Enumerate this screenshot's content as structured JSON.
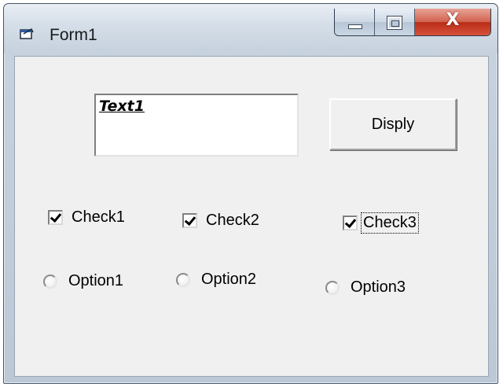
{
  "window": {
    "title": "Form1",
    "close_glyph": "X",
    "icons": {
      "app": "form-app-icon",
      "minimize": "minimize-icon",
      "maximize": "maximize-icon",
      "close": "close-icon"
    }
  },
  "form": {
    "textbox": {
      "value": "Text1"
    },
    "button": {
      "label": "Disply"
    },
    "checkboxes": [
      {
        "label": "Check1",
        "checked": true
      },
      {
        "label": "Check2",
        "checked": true
      },
      {
        "label": "Check3",
        "checked": true,
        "focused": true
      }
    ],
    "options": [
      {
        "label": "Option1",
        "selected": false
      },
      {
        "label": "Option2",
        "selected": false
      },
      {
        "label": "Option3",
        "selected": false
      }
    ]
  }
}
